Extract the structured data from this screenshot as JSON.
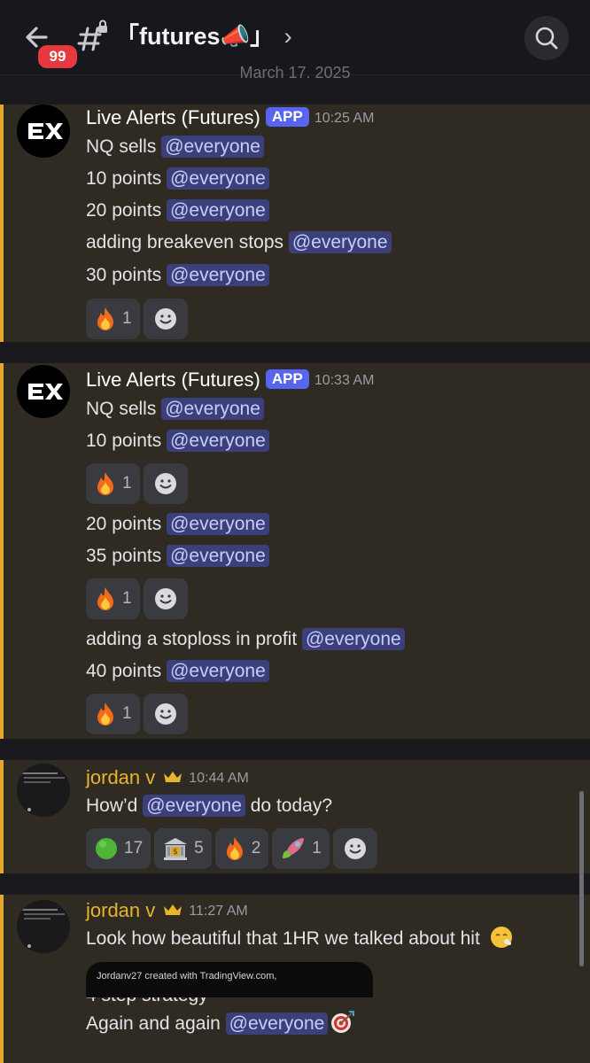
{
  "header": {
    "back_badge": "99",
    "channel_name": "「futures📣」",
    "chevron": "›"
  },
  "date_divider": "March 17, 2025",
  "messages": [
    {
      "author": "Live Alerts (Futures)",
      "tag": "APP",
      "time": "10:25 AM",
      "lines": [
        {
          "text": "NQ sells ",
          "mention": "@everyone"
        },
        {
          "text": "10 points  ",
          "mention": "@everyone"
        },
        {
          "text": "20 points  ",
          "mention": "@everyone"
        },
        {
          "text": "adding breakeven stops  ",
          "mention": "@everyone"
        },
        {
          "text": "30 points  ",
          "mention": "@everyone"
        }
      ],
      "reactions": [
        {
          "emoji": "fire",
          "count": "1"
        }
      ]
    },
    {
      "author": "Live Alerts (Futures)",
      "tag": "APP",
      "time": "10:33 AM",
      "lines": [
        {
          "text": "NQ sells  ",
          "mention": "@everyone"
        },
        {
          "text": "10 points  ",
          "mention": "@everyone"
        },
        {
          "text": "20 points  ",
          "mention": "@everyone"
        },
        {
          "text": "35 points  ",
          "mention": "@everyone"
        },
        {
          "text": "adding a stoploss in profit  ",
          "mention": "@everyone"
        },
        {
          "text": "40 points  ",
          "mention": "@everyone"
        }
      ],
      "reactions": [
        {
          "emoji": "fire",
          "count": "1"
        },
        {
          "emoji": "fire",
          "count": "1"
        },
        {
          "emoji": "fire",
          "count": "1"
        }
      ]
    },
    {
      "author": "jordan v",
      "time": "10:44 AM",
      "line_pre": "How’d ",
      "mention": "@everyone",
      "line_post": " do today?",
      "reactions": [
        {
          "emoji": "green-circle",
          "count": "17"
        },
        {
          "emoji": "bank",
          "count": "5"
        },
        {
          "emoji": "fire",
          "count": "2"
        },
        {
          "emoji": "rocket",
          "count": "1"
        }
      ]
    },
    {
      "author": "jordan v",
      "time": "11:27 AM",
      "line1": "Look how beautiful that 1HR we talked about hit",
      "line2": "4 step strategy",
      "line3_pre": "Again and again ",
      "mention": "@everyone",
      "embed_caption": "Jordanv27 created with TradingView.com,"
    }
  ],
  "colors": {
    "highlight_bar": "#e3a72a",
    "mention_bg": "#3b3f7a",
    "app_tag": "#5865f2",
    "username_gold": "#e6b52c",
    "badge_red": "#e6383f"
  }
}
